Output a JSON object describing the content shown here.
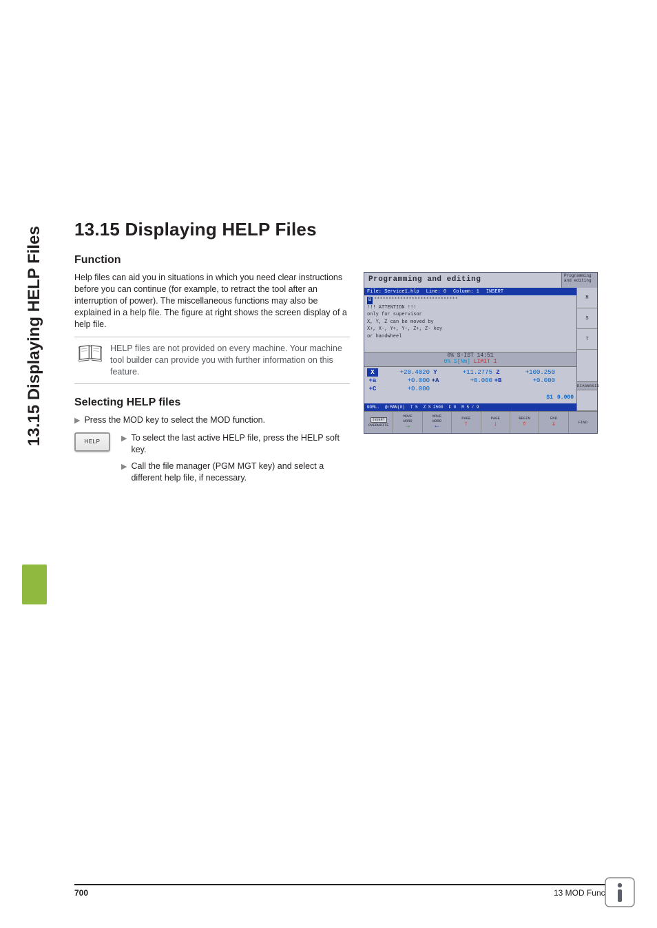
{
  "sideTab": "13.15 Displaying HELP Files",
  "heading": "13.15 Displaying HELP Files",
  "section1": {
    "title": "Function",
    "para": "Help files can aid you in situations in which you need clear instructions before you can continue (for example, to retract the tool after an interruption of power). The miscellaneous functions may also be explained in a help file. The figure at right shows the screen display of a help file.",
    "note": "HELP files are not provided on every machine. Your machine tool builder can provide you with further information on this feature."
  },
  "section2": {
    "title": "Selecting HELP files",
    "step1": "Press the MOD key to select the MOD function.",
    "softkeyLabel": "HELP",
    "step2": "To select the last active HELP file, press the HELP soft key.",
    "step3": "Call the file manager (PGM MGT key) and select a different help file, if necessary."
  },
  "screenshot": {
    "title": "Programming and editing",
    "cornerLabel": "Programming and editing",
    "filebar": {
      "file": "File: Service1.hlp",
      "line": "Line: 0",
      "col": "Column: 1",
      "mode": "INSERT"
    },
    "editorLines": [
      "*****************************",
      "   !!! ATTENTION !!!",
      "   only for supervisor",
      "",
      " X, Y, Z can be moved by",
      " X+, X-, Y+, Y-, Z+, Z- key",
      "   or handwheel"
    ],
    "status": {
      "line1": "0% S-IST 14:51",
      "line2_a": "0% S[Nm]",
      "line2_b": "LIMIT 1"
    },
    "coords": {
      "row1": [
        {
          "ax": "X",
          "v": "+20.4020"
        },
        {
          "ax": "Y",
          "v": "+11.2775"
        },
        {
          "ax": "Z",
          "v": "+100.250"
        }
      ],
      "row2": [
        {
          "ax": "+a",
          "v": "+0.000"
        },
        {
          "ax": "+A",
          "v": "+0.000"
        },
        {
          "ax": "+B",
          "v": "+0.000"
        }
      ],
      "row3": [
        {
          "ax": "+C",
          "v": "+0.000"
        }
      ],
      "s": {
        "label": "S1",
        "val": "0.000"
      }
    },
    "bottombar": {
      "a": "NOML.",
      "b": "@:MAN(0)",
      "c": "T 5",
      "d": "Z S 2500",
      "e": "F 0",
      "f": "M 5 / 9"
    },
    "softkeys": [
      {
        "l1": "INSERT",
        "l2": "OVERWRITE",
        "icon": ""
      },
      {
        "l1": "MOVE",
        "l2": "WORD",
        "icon": "right"
      },
      {
        "l1": "MOVE",
        "l2": "WORD",
        "icon": "left"
      },
      {
        "l1": "PAGE",
        "l2": "",
        "icon": "up"
      },
      {
        "l1": "PAGE",
        "l2": "",
        "icon": "down"
      },
      {
        "l1": "BEGIN",
        "l2": "",
        "icon": "up"
      },
      {
        "l1": "END",
        "l2": "",
        "icon": "down"
      },
      {
        "l1": "FIND",
        "l2": "",
        "icon": ""
      }
    ],
    "rightButtons": [
      "M",
      "S",
      "T"
    ],
    "diag": "DIAGNOSIS"
  },
  "footer": {
    "page": "700",
    "chapter": "13 MOD Functions"
  }
}
